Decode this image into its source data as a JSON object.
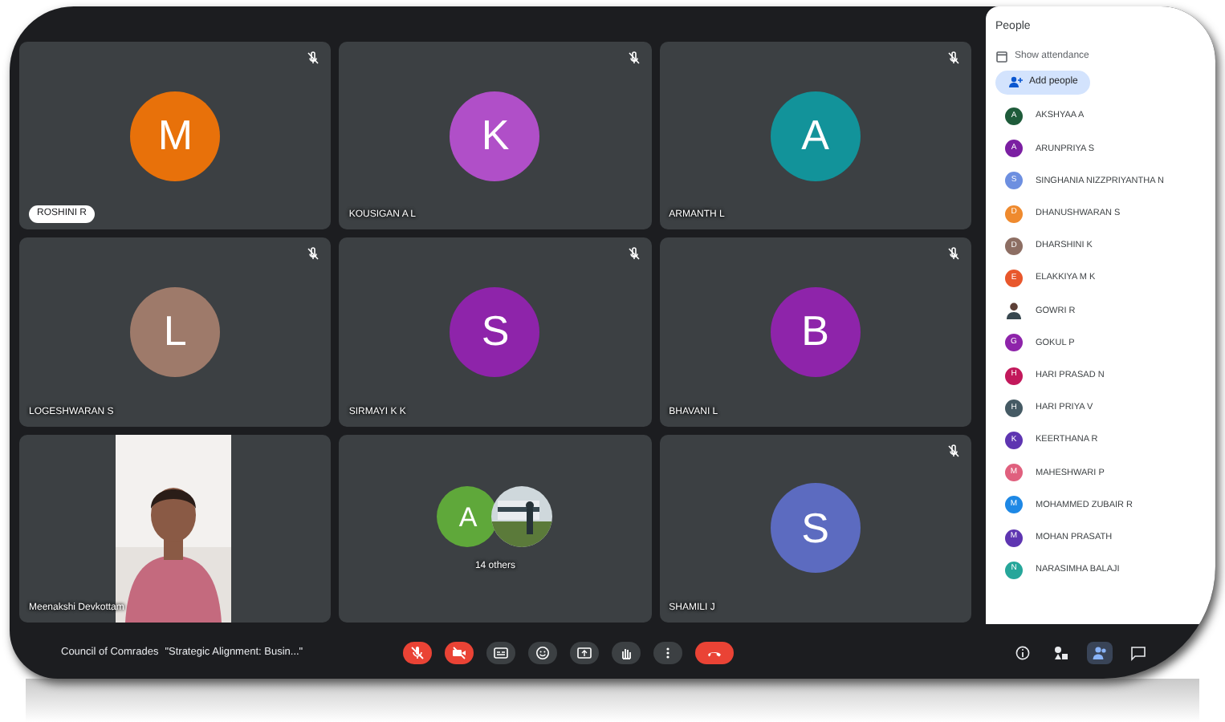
{
  "tiles": [
    {
      "kind": "avatar",
      "initial": "M",
      "color": "#e8710a",
      "name": "ROSHINI R",
      "highlighted": true,
      "muted": true
    },
    {
      "kind": "avatar",
      "initial": "K",
      "color": "#b04fc8",
      "name": "KOUSIGAN A L",
      "highlighted": false,
      "muted": true
    },
    {
      "kind": "avatar",
      "initial": "A",
      "color": "#12939a",
      "name": "ARMANTH L",
      "highlighted": false,
      "muted": true
    },
    {
      "kind": "avatar",
      "initial": "L",
      "color": "#9e7a6a",
      "name": "LOGESHWARAN S",
      "highlighted": false,
      "muted": true
    },
    {
      "kind": "avatar",
      "initial": "S",
      "color": "#8e24aa",
      "name": "SIRMAYI K K",
      "highlighted": false,
      "muted": true
    },
    {
      "kind": "avatar",
      "initial": "B",
      "color": "#8e24aa",
      "name": "BHAVANI L",
      "highlighted": false,
      "muted": true
    },
    {
      "kind": "video",
      "name": "Meenakshi Devkottam",
      "highlighted": false,
      "muted": false
    },
    {
      "kind": "group",
      "initial": "A",
      "color": "#5fa83a",
      "name": "14 others",
      "highlighted": false,
      "muted": false
    },
    {
      "kind": "avatar",
      "initial": "S",
      "color": "#5c6bc0",
      "name": "SHAMILI J",
      "highlighted": false,
      "muted": true
    }
  ],
  "people_panel": {
    "title": "People",
    "show_attendance": "Show attendance",
    "add_people": "Add people",
    "people": [
      {
        "kind": "avatar",
        "initial": "A",
        "color": "#1e5b3a",
        "name": "AKSHYAA A"
      },
      {
        "kind": "avatar",
        "initial": "A",
        "color": "#7b1fa2",
        "name": "ARUNPRIYA S"
      },
      {
        "kind": "avatar",
        "initial": "S",
        "color": "#6d8fe0",
        "name": "SINGHANIA NIZZPRIYANTHA N"
      },
      {
        "kind": "avatar",
        "initial": "D",
        "color": "#ef8a2e",
        "name": "DHANUSHWARAN S"
      },
      {
        "kind": "avatar",
        "initial": "D",
        "color": "#8d6e63",
        "name": "DHARSHINI K"
      },
      {
        "kind": "avatar",
        "initial": "E",
        "color": "#e8572c",
        "name": "ELAKKIYA M K"
      },
      {
        "name": "GOWRI R"
      },
      {
        "kind": "avatar",
        "initial": "G",
        "color": "#8e24aa",
        "name": "GOKUL P"
      },
      {
        "kind": "avatar",
        "initial": "H",
        "color": "#c2185b",
        "name": "HARI PRASAD N"
      },
      {
        "kind": "avatar",
        "initial": "H",
        "color": "#455a64",
        "name": "HARI PRIYA V"
      },
      {
        "kind": "avatar",
        "initial": "K",
        "color": "#5e35b1",
        "name": "KEERTHANA R"
      },
      {
        "kind": "avatar",
        "initial": "M",
        "color": "#e0607e",
        "name": "MAHESHWARI P"
      },
      {
        "kind": "avatar",
        "initial": "M",
        "color": "#1e88e5",
        "name": "MOHAMMED ZUBAIR R"
      },
      {
        "kind": "avatar",
        "initial": "M",
        "color": "#5e35b1",
        "name": "MOHAN PRASATH"
      },
      {
        "kind": "avatar",
        "initial": "N",
        "color": "#26a69a",
        "name": "NARASIMHA BALAJI"
      }
    ]
  },
  "bottom_bar": {
    "meeting": "Council of Comrades",
    "title": "\"Strategic Alignment: Busin...\"",
    "controls": [
      {
        "kind": "mic",
        "on": false
      },
      {
        "kind": "camera",
        "on": false
      },
      {
        "kind": "captions",
        "on": true
      },
      {
        "kind": "emoji",
        "on": true
      },
      {
        "kind": "present",
        "on": true
      },
      {
        "kind": "hand",
        "on": true
      },
      {
        "kind": "more",
        "on": true
      },
      {
        "kind": "end"
      }
    ],
    "side_buttons": [
      {
        "kind": "info",
        "selected": false
      },
      {
        "kind": "activities",
        "selected": false
      },
      {
        "kind": "people",
        "selected": true
      },
      {
        "kind": "chat",
        "selected": false
      }
    ]
  }
}
